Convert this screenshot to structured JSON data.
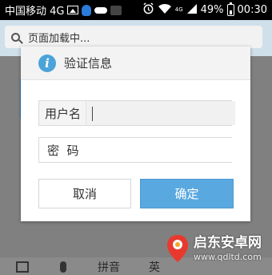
{
  "status_bar": {
    "carrier": "中国移动 4G",
    "network_small": "4G",
    "battery_percent": "49%",
    "time": "00:30"
  },
  "search": {
    "placeholder": "页面加载中..."
  },
  "dialog": {
    "title": "验证信息",
    "info_glyph": "i",
    "username_label": "用户名",
    "username_value": "",
    "password_label": "密  码",
    "password_value": "",
    "cancel_label": "取消",
    "confirm_label": "确定"
  },
  "keyboard_bar": {
    "pinyin_label": "拼音",
    "partial_label": "英"
  },
  "watermark": {
    "title": "启东安卓网",
    "url": "www.qdltd.com"
  },
  "colors": {
    "accent": "#5aa8e0",
    "info_icon": "#4ba3d9",
    "status_bar": "#000000",
    "overlay": "#808080"
  },
  "icons": {
    "info": "info-icon",
    "search": "search-icon",
    "keyboard": "keyboard-icon",
    "mic": "microphone-icon",
    "battery": "battery-icon",
    "wifi": "wifi-icon",
    "alarm": "alarm-icon"
  }
}
